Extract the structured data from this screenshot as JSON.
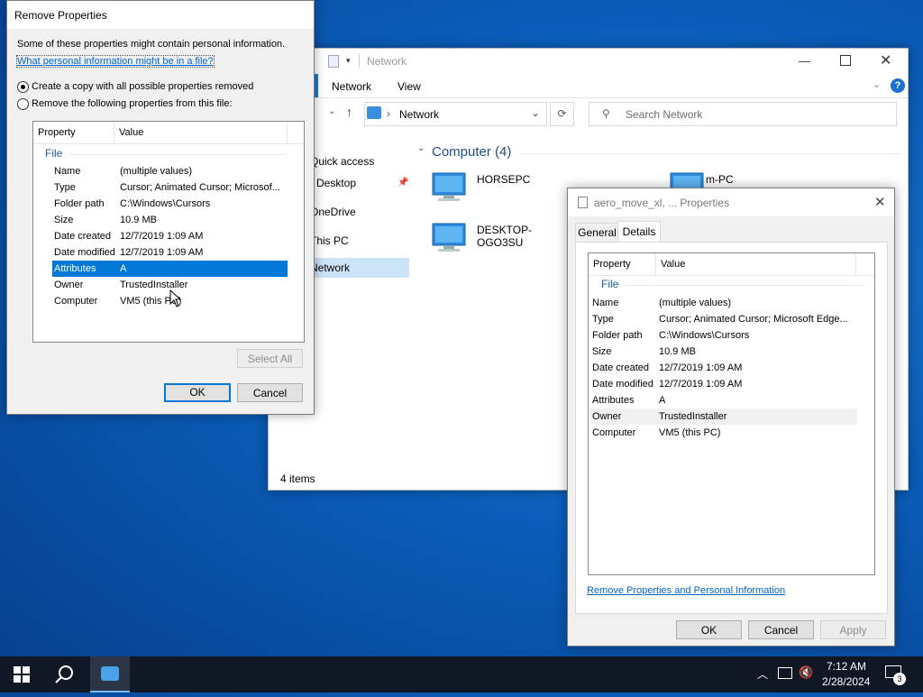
{
  "explorer": {
    "title": "Network",
    "tabs": [
      "Network",
      "View"
    ],
    "address": "Network",
    "search_placeholder": "Search Network",
    "nav": [
      "Quick access",
      "Desktop",
      "OneDrive",
      "This PC",
      "Network"
    ],
    "group_header": "Computer (4)",
    "computers": [
      "HORSEPC",
      "DESKTOP-OGO3SU",
      "m-PC"
    ],
    "status": "4 items"
  },
  "remove_dialog": {
    "title": "Remove Properties",
    "info_text": "Some of these properties might contain personal information.",
    "info_link": "What personal information might be in a file?",
    "option_copy": "Create a copy with all possible properties removed",
    "option_remove": "Remove the following properties from this file:",
    "col_property": "Property",
    "col_value": "Value",
    "group": "File",
    "rows": [
      {
        "name": "Name",
        "value": "(multiple values)"
      },
      {
        "name": "Type",
        "value": "Cursor; Animated Cursor; Microsof..."
      },
      {
        "name": "Folder path",
        "value": "C:\\Windows\\Cursors"
      },
      {
        "name": "Size",
        "value": "10.9 MB"
      },
      {
        "name": "Date created",
        "value": "12/7/2019 1:09 AM"
      },
      {
        "name": "Date modified",
        "value": "12/7/2019 1:09 AM"
      },
      {
        "name": "Attributes",
        "value": "A"
      },
      {
        "name": "Owner",
        "value": "TrustedInstaller"
      },
      {
        "name": "Computer",
        "value": "VM5 (this PC)"
      }
    ],
    "select_all": "Select All",
    "ok": "OK",
    "cancel": "Cancel"
  },
  "props_dialog": {
    "title": "aero_move_xl, ... Properties",
    "tabs": [
      "General",
      "Details"
    ],
    "col_property": "Property",
    "col_value": "Value",
    "group": "File",
    "rows": [
      {
        "name": "Name",
        "value": "(multiple values)"
      },
      {
        "name": "Type",
        "value": "Cursor; Animated Cursor; Microsoft Edge..."
      },
      {
        "name": "Folder path",
        "value": "C:\\Windows\\Cursors"
      },
      {
        "name": "Size",
        "value": "10.9 MB"
      },
      {
        "name": "Date created",
        "value": "12/7/2019 1:09 AM"
      },
      {
        "name": "Date modified",
        "value": "12/7/2019 1:09 AM"
      },
      {
        "name": "Attributes",
        "value": "A"
      },
      {
        "name": "Owner",
        "value": "TrustedInstaller"
      },
      {
        "name": "Computer",
        "value": "VM5 (this PC)"
      }
    ],
    "remove_link": "Remove Properties and Personal Information",
    "ok": "OK",
    "cancel": "Cancel",
    "apply": "Apply"
  },
  "taskbar": {
    "time": "7:12 AM",
    "date": "2/28/2024",
    "notification_count": "3"
  },
  "colors": {
    "accent": "#0078d7",
    "selection": "#0078d7",
    "link": "#0066cc"
  }
}
